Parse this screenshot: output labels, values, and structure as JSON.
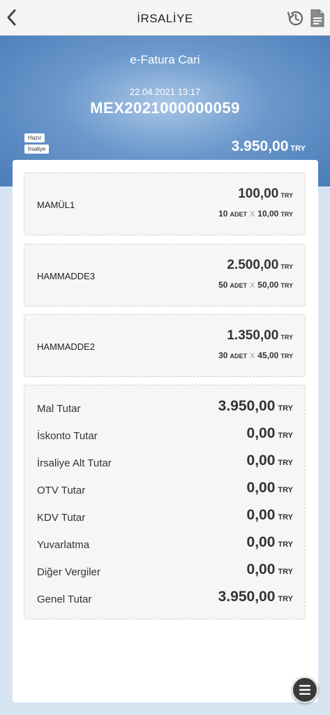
{
  "header": {
    "title": "İRSALİYE"
  },
  "hero": {
    "name": "e-Fatura Cari",
    "date": "22.04.2021 13:17",
    "number": "MEX2021000000059",
    "badges": [
      "Hazır",
      "İrsaliye"
    ],
    "total": "3.950,00",
    "currency": "TRY"
  },
  "items": [
    {
      "name": "MAMÜL1",
      "amount": "100,00",
      "currency": "TRY",
      "qty": "10",
      "unit": "ADET",
      "price": "10,00"
    },
    {
      "name": "HAMMADDE3",
      "amount": "2.500,00",
      "currency": "TRY",
      "qty": "50",
      "unit": "ADET",
      "price": "50,00"
    },
    {
      "name": "HAMMADDE2",
      "amount": "1.350,00",
      "currency": "TRY",
      "qty": "30",
      "unit": "ADET",
      "price": "45,00"
    }
  ],
  "separator": "X",
  "totals": [
    {
      "label": "Mal Tutar",
      "value": "3.950,00",
      "currency": "TRY"
    },
    {
      "label": "İskonto Tutar",
      "value": "0,00",
      "currency": "TRY"
    },
    {
      "label": "İrsaliye Alt Tutar",
      "value": "0,00",
      "currency": "TRY"
    },
    {
      "label": "OTV Tutar",
      "value": "0,00",
      "currency": "TRY"
    },
    {
      "label": "KDV Tutar",
      "value": "0,00",
      "currency": "TRY"
    },
    {
      "label": "Yuvarlatma",
      "value": "0,00",
      "currency": "TRY"
    },
    {
      "label": "Diğer Vergiler",
      "value": "0,00",
      "currency": "TRY"
    },
    {
      "label": "Genel Tutar",
      "value": "3.950,00",
      "currency": "TRY"
    }
  ],
  "icons": {
    "back": "chevron-left-icon",
    "history": "history-icon",
    "document": "document-icon",
    "menu": "menu-icon"
  }
}
